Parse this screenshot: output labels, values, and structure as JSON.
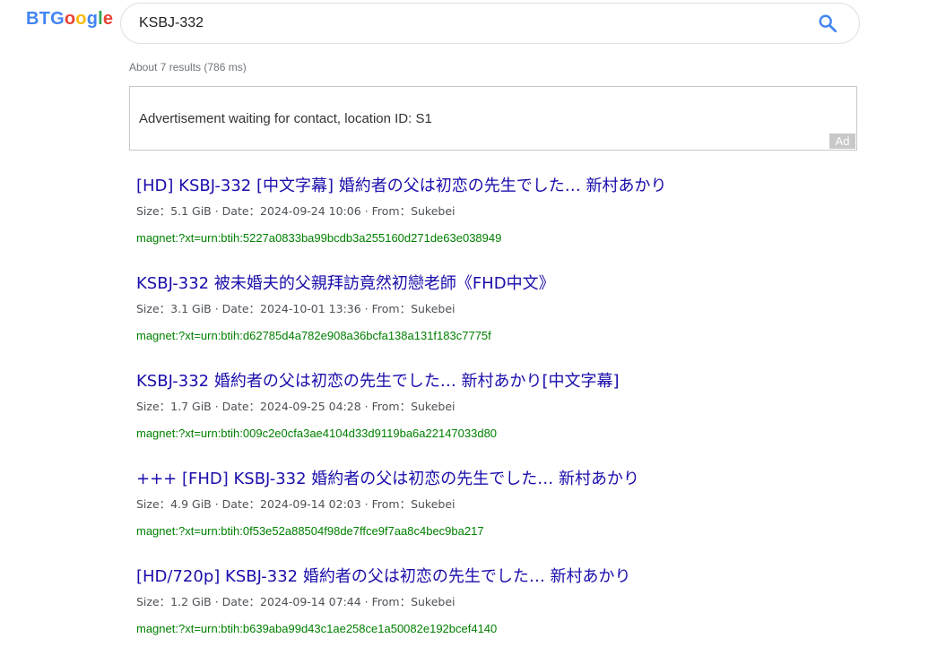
{
  "logo": {
    "letters": [
      {
        "char": "B",
        "color": "#4285f4"
      },
      {
        "char": "T",
        "color": "#4285f4"
      },
      {
        "char": "G",
        "color": "#4285f4"
      },
      {
        "char": "o",
        "color": "#ea4335"
      },
      {
        "char": "o",
        "color": "#fbbc05"
      },
      {
        "char": "g",
        "color": "#4285f4"
      },
      {
        "char": "l",
        "color": "#34a853"
      },
      {
        "char": "e",
        "color": "#ea4335"
      }
    ]
  },
  "search": {
    "value": "KSBJ-332",
    "icon": "search-icon",
    "icon_color": "#4285f4"
  },
  "stats": {
    "text": "About 7 results (786 ms)"
  },
  "ad": {
    "text": "Advertisement waiting for contact, location ID: S1",
    "label": "Ad"
  },
  "results": [
    {
      "title": "[HD] KSBJ-332 [中文字幕] 婚約者の父は初恋の先生でした… 新村あかり",
      "meta": "Size：5.1 GiB · Date：2024-09-24 10:06 · From：Sukebei",
      "magnet": "magnet:?xt=urn:btih:5227a0833ba99bcdb3a255160d271de63e038949"
    },
    {
      "title": "KSBJ-332 被未婚夫的父親拜訪竟然初戀老師《FHD中文》",
      "meta": "Size：3.1 GiB · Date：2024-10-01 13:36 · From：Sukebei",
      "magnet": "magnet:?xt=urn:btih:d62785d4a782e908a36bcfa138a131f183c7775f"
    },
    {
      "title": "KSBJ-332 婚約者の父は初恋の先生でした… 新村あかり[中文字幕]",
      "meta": "Size：1.7 GiB · Date：2024-09-25 04:28 · From：Sukebei",
      "magnet": "magnet:?xt=urn:btih:009c2e0cfa3ae4104d33d9119ba6a22147033d80"
    },
    {
      "title": "+++ [FHD] KSBJ-332 婚約者の父は初恋の先生でした… 新村あかり",
      "meta": "Size：4.9 GiB · Date：2024-09-14 02:03 · From：Sukebei",
      "magnet": "magnet:?xt=urn:btih:0f53e52a88504f98de7ffce9f7aa8c4bec9ba217"
    },
    {
      "title": "[HD/720p] KSBJ-332 婚約者の父は初恋の先生でした… 新村あかり",
      "meta": "Size：1.2 GiB · Date：2024-09-14 07:44 · From：Sukebei",
      "magnet": "magnet:?xt=urn:btih:b639aba99d43c1ae258ce1a50082e192bcef4140"
    }
  ]
}
